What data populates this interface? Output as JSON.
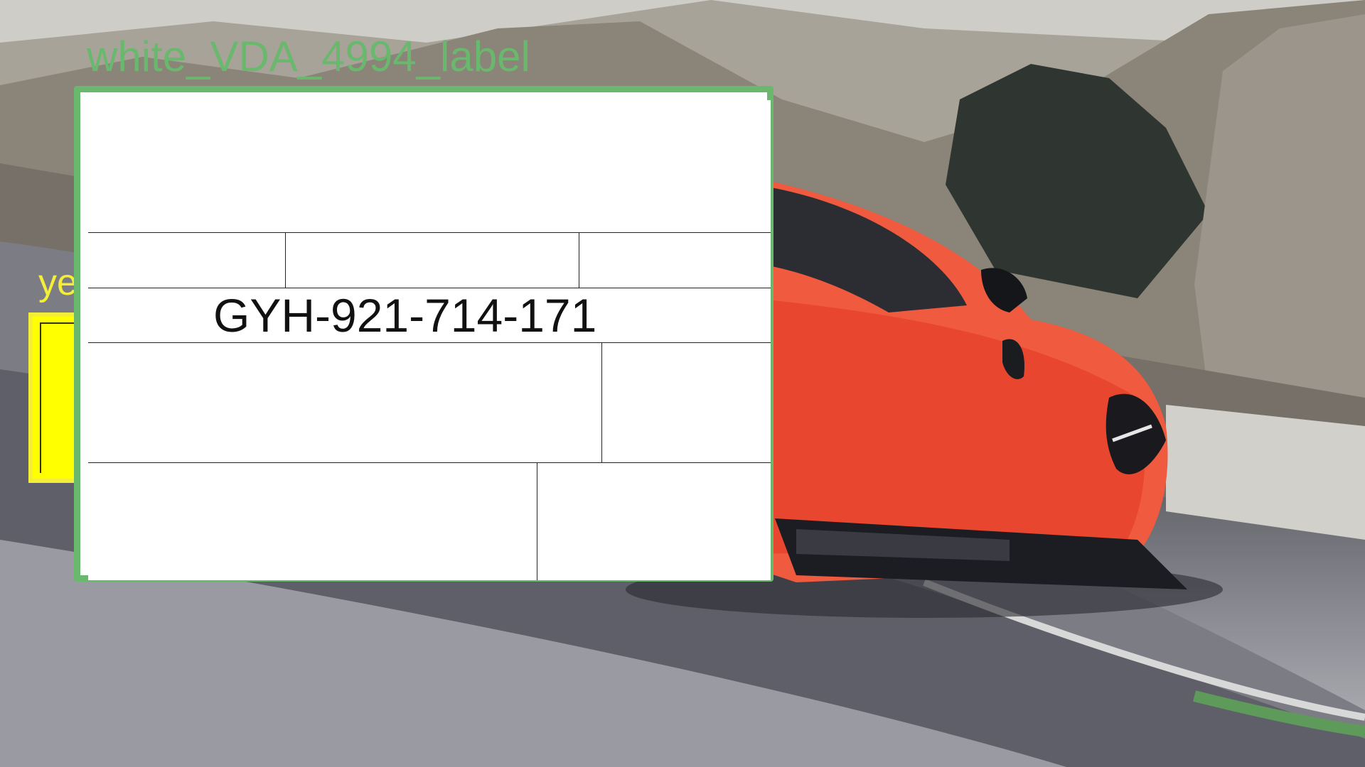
{
  "annotations": {
    "green": {
      "label": "white_VDA_4994_label",
      "color": "#6ab86e"
    },
    "yellow": {
      "label": "ye",
      "color": "#f2ee3a"
    }
  },
  "shipping_label": {
    "tracking_number": "GYH-921-714-171"
  },
  "background": {
    "subject": "orange sports car on race track"
  }
}
